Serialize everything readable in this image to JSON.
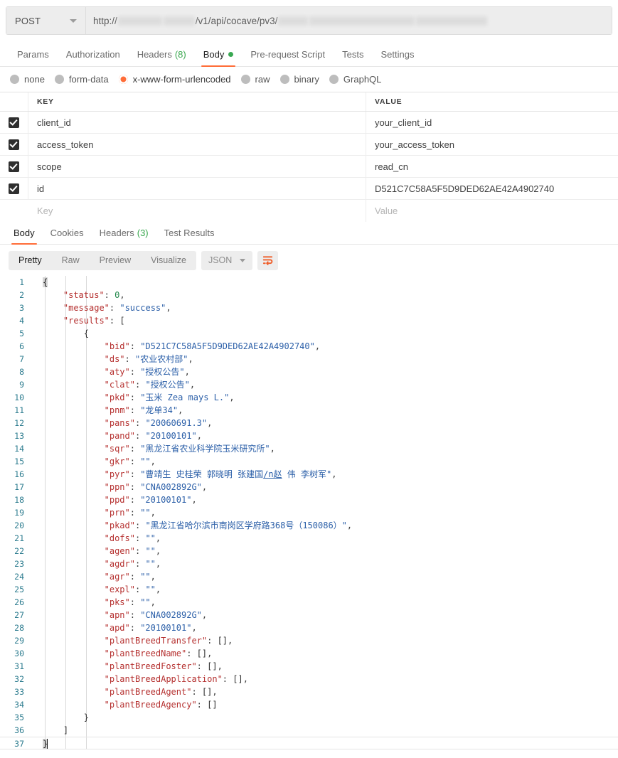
{
  "request": {
    "method": "POST",
    "method_caret_icon": "chevron-down-icon",
    "url_prefix": "http://",
    "url_middle": "/v1/api/cocave/pv3/",
    "url_redacted": true,
    "tabs": [
      {
        "label": "Params",
        "count": "",
        "active": false,
        "dot": false
      },
      {
        "label": "Authorization",
        "count": "",
        "active": false,
        "dot": false
      },
      {
        "label": "Headers",
        "count": "(8)",
        "active": false,
        "dot": false
      },
      {
        "label": "Body",
        "count": "",
        "active": true,
        "dot": true
      },
      {
        "label": "Pre-request Script",
        "count": "",
        "active": false,
        "dot": false
      },
      {
        "label": "Tests",
        "count": "",
        "active": false,
        "dot": false
      },
      {
        "label": "Settings",
        "count": "",
        "active": false,
        "dot": false
      }
    ],
    "body_types": [
      {
        "label": "none",
        "selected": false
      },
      {
        "label": "form-data",
        "selected": false
      },
      {
        "label": "x-www-form-urlencoded",
        "selected": true
      },
      {
        "label": "raw",
        "selected": false
      },
      {
        "label": "binary",
        "selected": false
      },
      {
        "label": "GraphQL",
        "selected": false
      }
    ],
    "table": {
      "headers": {
        "key": "KEY",
        "value": "VALUE"
      },
      "rows": [
        {
          "checked": true,
          "key": "client_id",
          "value": "your_client_id"
        },
        {
          "checked": true,
          "key": "access_token",
          "value": "your_access_token"
        },
        {
          "checked": true,
          "key": "scope",
          "value": "read_cn"
        },
        {
          "checked": true,
          "key": "id",
          "value": "D521C7C58A5F5D9DED62AE42A4902740"
        }
      ],
      "placeholder": {
        "key": "Key",
        "value": "Value"
      }
    }
  },
  "response": {
    "tabs": [
      {
        "label": "Body",
        "count": "",
        "active": true
      },
      {
        "label": "Cookies",
        "count": "",
        "active": false
      },
      {
        "label": "Headers",
        "count": "(3)",
        "active": false
      },
      {
        "label": "Test Results",
        "count": "",
        "active": false
      }
    ],
    "view_modes": [
      {
        "label": "Pretty",
        "active": true
      },
      {
        "label": "Raw",
        "active": false
      },
      {
        "label": "Preview",
        "active": false
      },
      {
        "label": "Visualize",
        "active": false
      }
    ],
    "format": "JSON",
    "format_caret_icon": "chevron-down-icon",
    "wrap_icon": "wrap-text-icon",
    "accent_color": "#ff6c37",
    "body_lines": [
      {
        "n": 1,
        "indent": 0,
        "parts": [
          {
            "t": "brace-hl",
            "v": "{"
          }
        ]
      },
      {
        "n": 2,
        "indent": 1,
        "parts": [
          {
            "t": "key",
            "v": "\"status\""
          },
          {
            "t": "pun",
            "v": ": "
          },
          {
            "t": "num",
            "v": "0"
          },
          {
            "t": "pun",
            "v": ","
          }
        ]
      },
      {
        "n": 3,
        "indent": 1,
        "parts": [
          {
            "t": "key",
            "v": "\"message\""
          },
          {
            "t": "pun",
            "v": ": "
          },
          {
            "t": "str",
            "v": "\"success\""
          },
          {
            "t": "pun",
            "v": ","
          }
        ]
      },
      {
        "n": 4,
        "indent": 1,
        "parts": [
          {
            "t": "key",
            "v": "\"results\""
          },
          {
            "t": "pun",
            "v": ": "
          },
          {
            "t": "brace",
            "v": "["
          }
        ]
      },
      {
        "n": 5,
        "indent": 2,
        "parts": [
          {
            "t": "brace",
            "v": "{"
          }
        ]
      },
      {
        "n": 6,
        "indent": 3,
        "parts": [
          {
            "t": "key",
            "v": "\"bid\""
          },
          {
            "t": "pun",
            "v": ": "
          },
          {
            "t": "str",
            "v": "\"D521C7C58A5F5D9DED62AE42A4902740\""
          },
          {
            "t": "pun",
            "v": ","
          }
        ]
      },
      {
        "n": 7,
        "indent": 3,
        "parts": [
          {
            "t": "key",
            "v": "\"ds\""
          },
          {
            "t": "pun",
            "v": ": "
          },
          {
            "t": "str",
            "v": "\"农业农村部\""
          },
          {
            "t": "pun",
            "v": ","
          }
        ]
      },
      {
        "n": 8,
        "indent": 3,
        "parts": [
          {
            "t": "key",
            "v": "\"aty\""
          },
          {
            "t": "pun",
            "v": ": "
          },
          {
            "t": "str",
            "v": "\"授权公告\""
          },
          {
            "t": "pun",
            "v": ","
          }
        ]
      },
      {
        "n": 9,
        "indent": 3,
        "parts": [
          {
            "t": "key",
            "v": "\"clat\""
          },
          {
            "t": "pun",
            "v": ": "
          },
          {
            "t": "str",
            "v": "\"授权公告\""
          },
          {
            "t": "pun",
            "v": ","
          }
        ]
      },
      {
        "n": 10,
        "indent": 3,
        "parts": [
          {
            "t": "key",
            "v": "\"pkd\""
          },
          {
            "t": "pun",
            "v": ": "
          },
          {
            "t": "str",
            "v": "\"玉米 Zea mays L.\""
          },
          {
            "t": "pun",
            "v": ","
          }
        ]
      },
      {
        "n": 11,
        "indent": 3,
        "parts": [
          {
            "t": "key",
            "v": "\"pnm\""
          },
          {
            "t": "pun",
            "v": ": "
          },
          {
            "t": "str",
            "v": "\"龙单34\""
          },
          {
            "t": "pun",
            "v": ","
          }
        ]
      },
      {
        "n": 12,
        "indent": 3,
        "parts": [
          {
            "t": "key",
            "v": "\"pans\""
          },
          {
            "t": "pun",
            "v": ": "
          },
          {
            "t": "str",
            "v": "\"20060691.3\""
          },
          {
            "t": "pun",
            "v": ","
          }
        ]
      },
      {
        "n": 13,
        "indent": 3,
        "parts": [
          {
            "t": "key",
            "v": "\"pand\""
          },
          {
            "t": "pun",
            "v": ": "
          },
          {
            "t": "str",
            "v": "\"20100101\""
          },
          {
            "t": "pun",
            "v": ","
          }
        ]
      },
      {
        "n": 14,
        "indent": 3,
        "parts": [
          {
            "t": "key",
            "v": "\"sqr\""
          },
          {
            "t": "pun",
            "v": ": "
          },
          {
            "t": "str",
            "v": "\"黑龙江省农业科学院玉米研究所\""
          },
          {
            "t": "pun",
            "v": ","
          }
        ]
      },
      {
        "n": 15,
        "indent": 3,
        "parts": [
          {
            "t": "key",
            "v": "\"gkr\""
          },
          {
            "t": "pun",
            "v": ": "
          },
          {
            "t": "str",
            "v": "\"\""
          },
          {
            "t": "pun",
            "v": ","
          }
        ]
      },
      {
        "n": 16,
        "indent": 3,
        "parts": [
          {
            "t": "key",
            "v": "\"pyr\""
          },
          {
            "t": "pun",
            "v": ": "
          },
          {
            "t": "str",
            "v": "\"曹靖生 史桂荣 郭晓明 张建国"
          },
          {
            "t": "link",
            "v": "/n赵"
          },
          {
            "t": "str",
            "v": " 伟 李树军\""
          },
          {
            "t": "pun",
            "v": ","
          }
        ]
      },
      {
        "n": 17,
        "indent": 3,
        "parts": [
          {
            "t": "key",
            "v": "\"ppn\""
          },
          {
            "t": "pun",
            "v": ": "
          },
          {
            "t": "str",
            "v": "\"CNA002892G\""
          },
          {
            "t": "pun",
            "v": ","
          }
        ]
      },
      {
        "n": 18,
        "indent": 3,
        "parts": [
          {
            "t": "key",
            "v": "\"ppd\""
          },
          {
            "t": "pun",
            "v": ": "
          },
          {
            "t": "str",
            "v": "\"20100101\""
          },
          {
            "t": "pun",
            "v": ","
          }
        ]
      },
      {
        "n": 19,
        "indent": 3,
        "parts": [
          {
            "t": "key",
            "v": "\"prn\""
          },
          {
            "t": "pun",
            "v": ": "
          },
          {
            "t": "str",
            "v": "\"\""
          },
          {
            "t": "pun",
            "v": ","
          }
        ]
      },
      {
        "n": 20,
        "indent": 3,
        "parts": [
          {
            "t": "key",
            "v": "\"pkad\""
          },
          {
            "t": "pun",
            "v": ": "
          },
          {
            "t": "str",
            "v": "\"黑龙江省哈尔滨市南岗区学府路368号（150086）\""
          },
          {
            "t": "pun",
            "v": ","
          }
        ]
      },
      {
        "n": 21,
        "indent": 3,
        "parts": [
          {
            "t": "key",
            "v": "\"dofs\""
          },
          {
            "t": "pun",
            "v": ": "
          },
          {
            "t": "str",
            "v": "\"\""
          },
          {
            "t": "pun",
            "v": ","
          }
        ]
      },
      {
        "n": 22,
        "indent": 3,
        "parts": [
          {
            "t": "key",
            "v": "\"agen\""
          },
          {
            "t": "pun",
            "v": ": "
          },
          {
            "t": "str",
            "v": "\"\""
          },
          {
            "t": "pun",
            "v": ","
          }
        ]
      },
      {
        "n": 23,
        "indent": 3,
        "parts": [
          {
            "t": "key",
            "v": "\"agdr\""
          },
          {
            "t": "pun",
            "v": ": "
          },
          {
            "t": "str",
            "v": "\"\""
          },
          {
            "t": "pun",
            "v": ","
          }
        ]
      },
      {
        "n": 24,
        "indent": 3,
        "parts": [
          {
            "t": "key",
            "v": "\"agr\""
          },
          {
            "t": "pun",
            "v": ": "
          },
          {
            "t": "str",
            "v": "\"\""
          },
          {
            "t": "pun",
            "v": ","
          }
        ]
      },
      {
        "n": 25,
        "indent": 3,
        "parts": [
          {
            "t": "key",
            "v": "\"expl\""
          },
          {
            "t": "pun",
            "v": ": "
          },
          {
            "t": "str",
            "v": "\"\""
          },
          {
            "t": "pun",
            "v": ","
          }
        ]
      },
      {
        "n": 26,
        "indent": 3,
        "parts": [
          {
            "t": "key",
            "v": "\"pks\""
          },
          {
            "t": "pun",
            "v": ": "
          },
          {
            "t": "str",
            "v": "\"\""
          },
          {
            "t": "pun",
            "v": ","
          }
        ]
      },
      {
        "n": 27,
        "indent": 3,
        "parts": [
          {
            "t": "key",
            "v": "\"apn\""
          },
          {
            "t": "pun",
            "v": ": "
          },
          {
            "t": "str",
            "v": "\"CNA002892G\""
          },
          {
            "t": "pun",
            "v": ","
          }
        ]
      },
      {
        "n": 28,
        "indent": 3,
        "parts": [
          {
            "t": "key",
            "v": "\"apd\""
          },
          {
            "t": "pun",
            "v": ": "
          },
          {
            "t": "str",
            "v": "\"20100101\""
          },
          {
            "t": "pun",
            "v": ","
          }
        ]
      },
      {
        "n": 29,
        "indent": 3,
        "parts": [
          {
            "t": "key",
            "v": "\"plantBreedTransfer\""
          },
          {
            "t": "pun",
            "v": ": "
          },
          {
            "t": "brace",
            "v": "[]"
          },
          {
            "t": "pun",
            "v": ","
          }
        ]
      },
      {
        "n": 30,
        "indent": 3,
        "parts": [
          {
            "t": "key",
            "v": "\"plantBreedName\""
          },
          {
            "t": "pun",
            "v": ": "
          },
          {
            "t": "brace",
            "v": "[]"
          },
          {
            "t": "pun",
            "v": ","
          }
        ]
      },
      {
        "n": 31,
        "indent": 3,
        "parts": [
          {
            "t": "key",
            "v": "\"plantBreedFoster\""
          },
          {
            "t": "pun",
            "v": ": "
          },
          {
            "t": "brace",
            "v": "[]"
          },
          {
            "t": "pun",
            "v": ","
          }
        ]
      },
      {
        "n": 32,
        "indent": 3,
        "parts": [
          {
            "t": "key",
            "v": "\"plantBreedApplication\""
          },
          {
            "t": "pun",
            "v": ": "
          },
          {
            "t": "brace",
            "v": "[]"
          },
          {
            "t": "pun",
            "v": ","
          }
        ]
      },
      {
        "n": 33,
        "indent": 3,
        "parts": [
          {
            "t": "key",
            "v": "\"plantBreedAgent\""
          },
          {
            "t": "pun",
            "v": ": "
          },
          {
            "t": "brace",
            "v": "[]"
          },
          {
            "t": "pun",
            "v": ","
          }
        ]
      },
      {
        "n": 34,
        "indent": 3,
        "parts": [
          {
            "t": "key",
            "v": "\"plantBreedAgency\""
          },
          {
            "t": "pun",
            "v": ": "
          },
          {
            "t": "brace",
            "v": "[]"
          }
        ]
      },
      {
        "n": 35,
        "indent": 2,
        "parts": [
          {
            "t": "brace",
            "v": "}"
          }
        ]
      },
      {
        "n": 36,
        "indent": 1,
        "parts": [
          {
            "t": "brace",
            "v": "]"
          }
        ]
      },
      {
        "n": 37,
        "indent": 0,
        "current": true,
        "parts": [
          {
            "t": "brace-hl",
            "v": "}"
          },
          {
            "t": "caret",
            "v": ""
          }
        ]
      }
    ]
  }
}
